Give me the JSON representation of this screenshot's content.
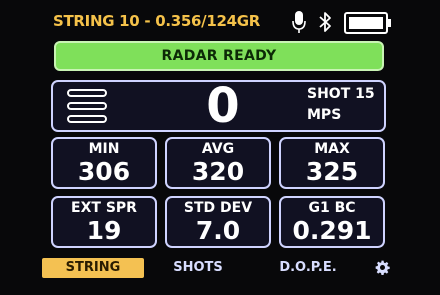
{
  "header": {
    "title": "STRING 10 - 0.356/124GR",
    "icons": [
      "microphone-icon",
      "bluetooth-icon",
      "battery-icon"
    ],
    "accent": "#f5c24a"
  },
  "status": {
    "text": "RADAR READY",
    "color": "#7fe05a"
  },
  "reading": {
    "velocity": "0",
    "shot_label": "SHOT 15",
    "unit": "MPS",
    "menu_icon": "menu-icon"
  },
  "stats": [
    {
      "label": "MIN",
      "value": "306"
    },
    {
      "label": "AVG",
      "value": "320"
    },
    {
      "label": "MAX",
      "value": "325"
    },
    {
      "label": "EXT SPR",
      "value": "19"
    },
    {
      "label": "STD DEV",
      "value": "7.0"
    },
    {
      "label": "G1 BC",
      "value": "0.291"
    }
  ],
  "tabs": [
    {
      "label": "STRING",
      "active": true
    },
    {
      "label": "SHOTS",
      "active": false
    },
    {
      "label": "D.O.P.E.",
      "active": false
    }
  ],
  "settings_icon": "gear-icon"
}
